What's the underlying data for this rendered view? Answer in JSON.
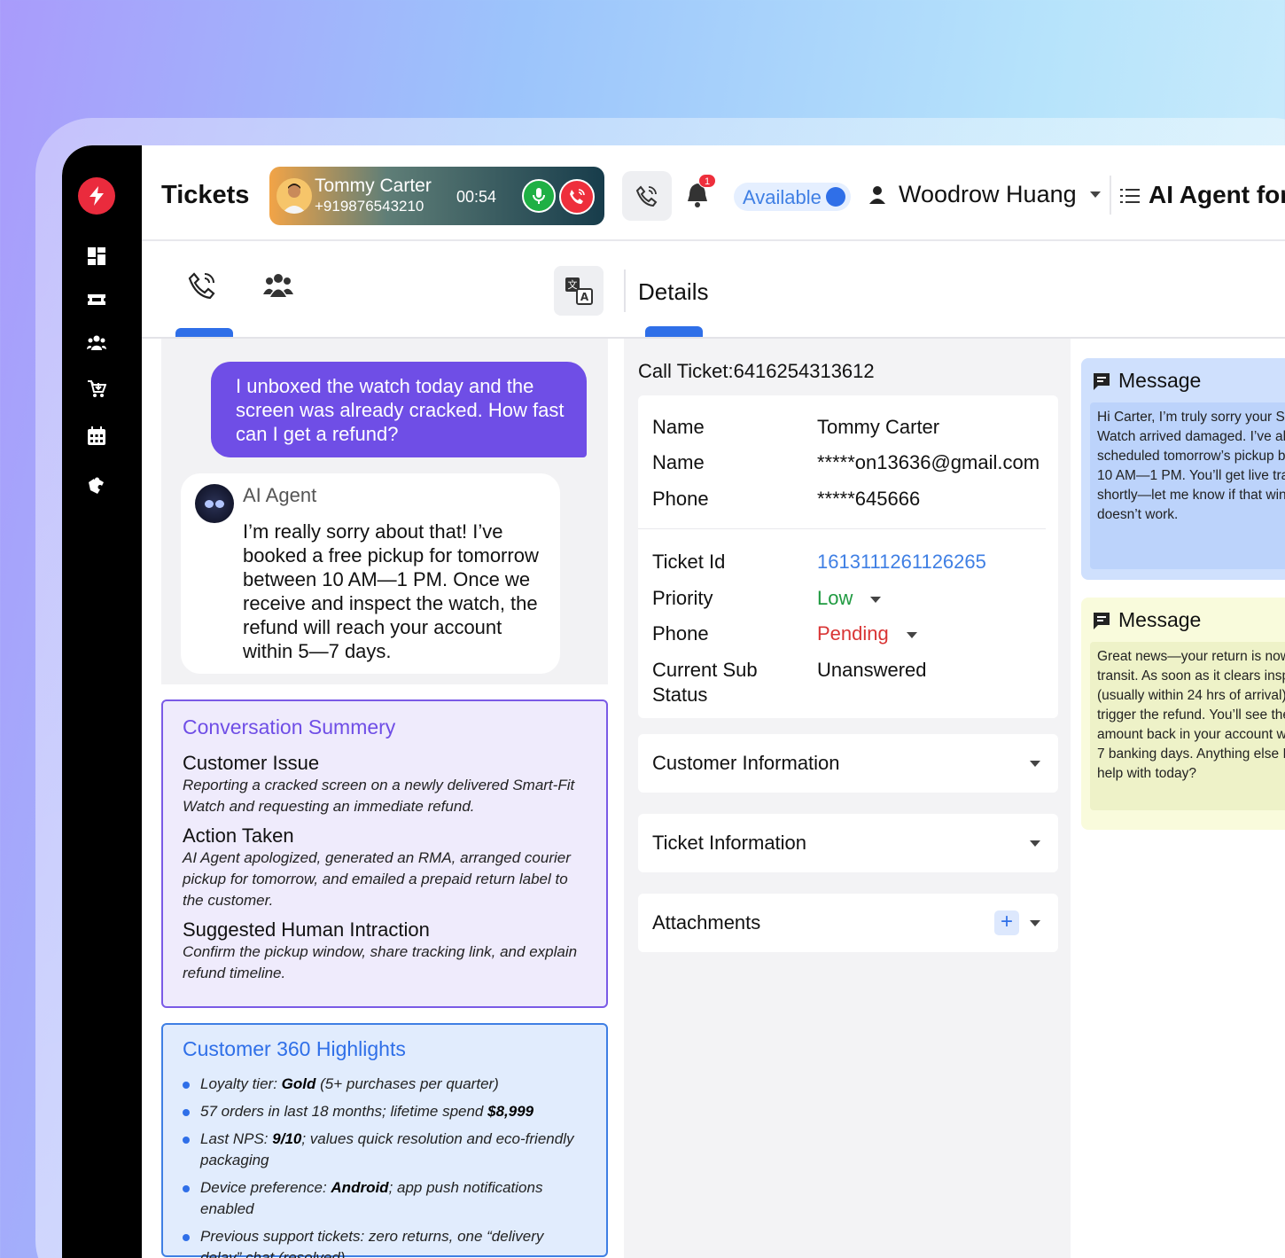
{
  "header": {
    "title": "Tickets",
    "call": {
      "name": "Tommy Carter",
      "phone": "+919876543210",
      "timer": "00:54"
    },
    "notification_count": "1",
    "status": "Available",
    "user": "Woodrow Huang",
    "agent_title": "AI Agent for"
  },
  "chat": {
    "user_message": "I unboxed the watch today and the screen was already cracked. How fast can I get a refund?",
    "ai_sender": "AI Agent",
    "ai_message": "I’m really sorry about that! I’ve booked a free pickup for tomorrow between 10 AM—1 PM. Once we receive and inspect the watch, the refund will reach your account within 5—7 days."
  },
  "summary": {
    "title": "Conversation Summery",
    "sections": [
      {
        "heading": "Customer Issue",
        "text": "Reporting a cracked screen on a newly delivered Smart-Fit Watch and requesting an immediate refund."
      },
      {
        "heading": "Action Taken",
        "text": "AI Agent apologized, generated an RMA, arranged courier pickup for tomorrow, and emailed a prepaid return label to the customer."
      },
      {
        "heading": "Suggested Human Intraction",
        "text": "Confirm the pickup window, share tracking link, and explain refund timeline."
      }
    ]
  },
  "highlights": {
    "title": "Customer 360 Highlights",
    "items": [
      {
        "pre": "Loyalty tier: ",
        "bold": "Gold",
        "post": " (5+ purchases per quarter)"
      },
      {
        "pre": "57 orders in last 18 months; lifetime spend ",
        "bold": "$8,999",
        "post": ""
      },
      {
        "pre": "Last NPS: ",
        "bold": "9/10",
        "post": "; values quick resolution and eco-friendly packaging"
      },
      {
        "pre": "Device preference: ",
        "bold": "Android",
        "post": "; app push notifications enabled"
      },
      {
        "pre": "Previous support tickets: zero returns, one “delivery delay” chat (resolved)",
        "bold": "",
        "post": ""
      }
    ]
  },
  "details": {
    "title": "Details",
    "ticket_header": "Call Ticket:6416254313612",
    "fields": [
      {
        "key": "Name",
        "value": "Tommy Carter"
      },
      {
        "key": "Name",
        "value": "*****on13636@gmail.com"
      },
      {
        "key": "Phone",
        "value": "*****645666"
      },
      {
        "key": "Ticket Id",
        "value": "1613111261126265"
      },
      {
        "key": "Priority",
        "value": "Low"
      },
      {
        "key": "Phone",
        "value": "Pending"
      },
      {
        "key": "Current Sub Status",
        "value": "Unanswered"
      }
    ],
    "sections": [
      "Customer Information",
      "Ticket Information",
      "Attachments"
    ],
    "add_symbol": "+"
  },
  "messages": [
    {
      "title": "Message",
      "text": "Hi Carter, I’m truly sorry your Smart-Fit Watch arrived damaged. I’ve already scheduled tomorrow’s pickup between 10 AM—1 PM. You’ll get live tracking shortly—let me know if that window doesn’t work."
    },
    {
      "title": "Message",
      "text": "Great news—your return is now in transit. As soon as it clears inspection (usually within 24 hrs of arrival), I’ll trigger the refund. You’ll see the amount back in your account within 5—7 banking days. Anything else I can help with today?"
    }
  ],
  "colors": {
    "accent_purple": "#6f4ee6",
    "accent_blue": "#2f6fe8",
    "danger": "#ee2f3c",
    "success": "#1fb044"
  },
  "icons": {
    "sidebar": [
      "dashboard-icon",
      "ticket-icon",
      "people-icon",
      "cart-icon",
      "calendar-icon",
      "puzzle-icon"
    ]
  }
}
